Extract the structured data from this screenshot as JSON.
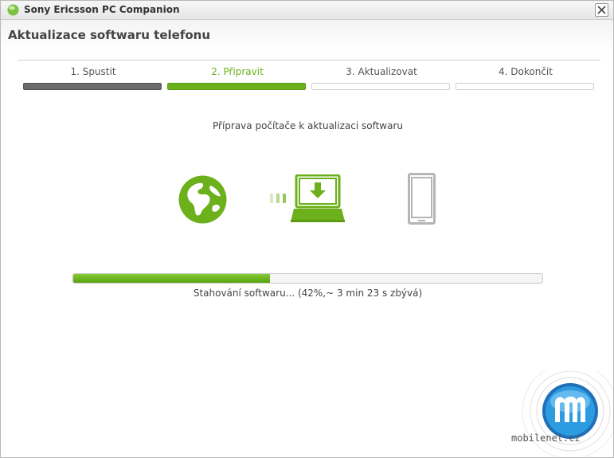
{
  "window": {
    "title": "Sony Ericsson PC Companion"
  },
  "page": {
    "title": "Aktualizace softwaru telefonu"
  },
  "steps": [
    {
      "label": "1. Spustit",
      "state": "done"
    },
    {
      "label": "2. Připravit",
      "state": "active"
    },
    {
      "label": "3. Aktualizovat",
      "state": "pending"
    },
    {
      "label": "4. Dokončit",
      "state": "pending"
    }
  ],
  "status": {
    "message": "Příprava počítače k aktualizaci softwaru"
  },
  "icons": {
    "source": "globe-icon",
    "transfer": "transfer-dots-icon",
    "computer": "laptop-download-icon",
    "device": "phone-icon"
  },
  "progress": {
    "fraction": 0.42,
    "text": "Stahování softwaru... (42%,~ 3 min 23 s zbývá)"
  },
  "watermark": {
    "text": "mobilenet.cz"
  },
  "colors": {
    "accent": "#6cb11b",
    "done": "#6b6b6b",
    "inactive_icon": "#b5b5b5"
  }
}
